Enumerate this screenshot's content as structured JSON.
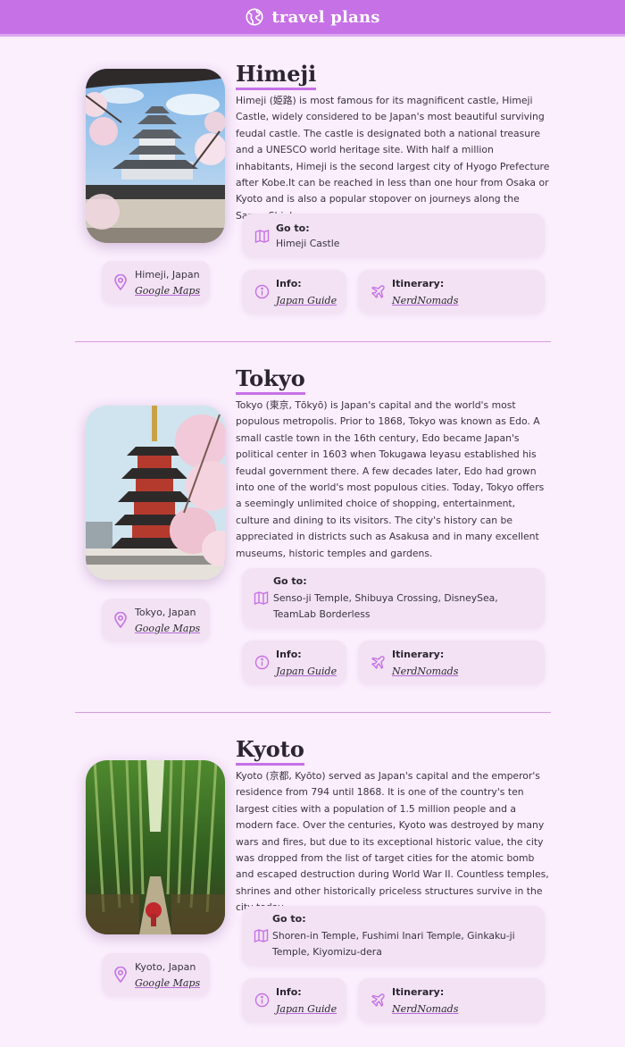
{
  "header": {
    "brand": "travel plans",
    "icon": "globe-icon",
    "color": "#c671e6"
  },
  "destinations": [
    {
      "name": "Himeji",
      "location": "Himeji, Japan",
      "maps_link": "Google Maps",
      "description": "Himeji (姫路) is most famous for its magnificent castle, Himeji Castle, widely considered to be Japan's most beautiful surviving feudal castle. The castle is designated both a national treasure and a UNESCO world heritage site. With half a million inhabitants, Himeji is the second largest city of Hyogo Prefecture after Kobe.It can be reached in less than one hour from Osaka or Kyoto and is also a popular stopover on journeys along the Sanyo Shinkansen.",
      "goto_label": "Go to:",
      "goto_value": "Himeji Castle",
      "info_label": "Info:",
      "info_link": "Japan Guide",
      "itinerary_label": "Itinerary:",
      "itinerary_link": "NerdNomads",
      "photo": "himeji-castle-photo"
    },
    {
      "name": "Tokyo",
      "location": "Tokyo, Japan",
      "maps_link": "Google Maps",
      "description": "Tokyo (東京, Tōkyō) is Japan's capital and the world's most populous metropolis. Prior to 1868, Tokyo was known as Edo. A small castle town in the 16th century, Edo became Japan's political center in 1603 when Tokugawa Ieyasu established his feudal government there. A few decades later, Edo had grown into one of the world's most populous cities. Today, Tokyo offers a seemingly unlimited choice of shopping, entertainment, culture and dining to its visitors. The city's history can be appreciated in districts such as Asakusa and in many excellent museums, historic temples and gardens.",
      "goto_label": "Go to:",
      "goto_value": "Senso-ji Temple, Shibuya Crossing, DisneySea, TeamLab Borderless",
      "info_label": "Info:",
      "info_link": "Japan Guide",
      "itinerary_label": "Itinerary:",
      "itinerary_link": "NerdNomads",
      "photo": "pagoda-photo"
    },
    {
      "name": "Kyoto",
      "location": "Kyoto, Japan",
      "maps_link": "Google Maps",
      "description": "Kyoto (京都, Kyōto) served as Japan's capital and the emperor's residence from 794 until 1868. It is one of the country's ten largest cities with a population of 1.5 million people and a modern face. Over the centuries, Kyoto was destroyed by many wars and fires, but due to its exceptional historic value, the city was dropped from the list of target cities for the atomic bomb and escaped destruction during World War II. Countless temples, shrines and other historically priceless structures survive in the city today.",
      "goto_label": "Go to:",
      "goto_value": "Shoren-in Temple, Fushimi Inari Temple, Ginkaku-ji Temple, Kiyomizu-dera",
      "info_label": "Info:",
      "info_link": "Japan Guide",
      "itinerary_label": "Itinerary:",
      "itinerary_link": "NerdNomads",
      "photo": "bamboo-forest-photo"
    }
  ]
}
